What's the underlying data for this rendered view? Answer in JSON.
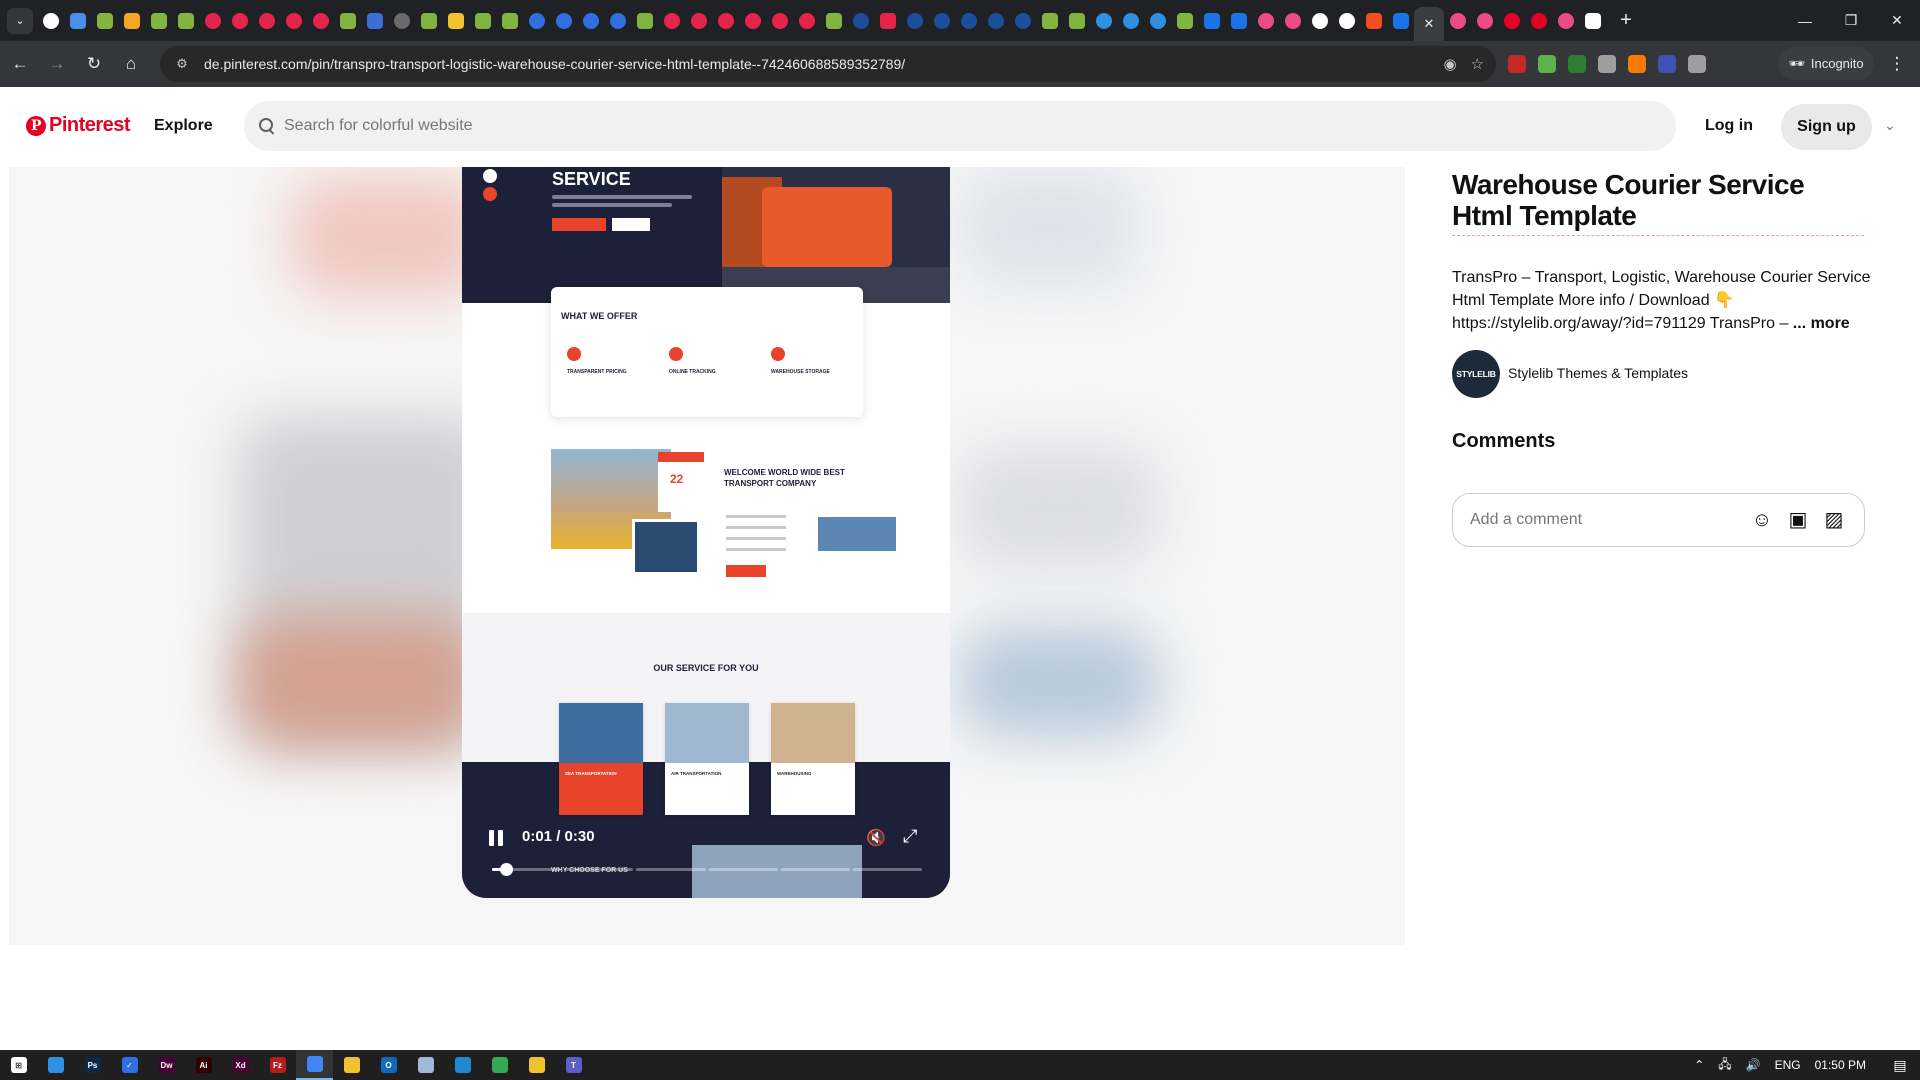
{
  "browser": {
    "tab_favicons": [
      {
        "name": "google-favicon",
        "color": "#ffffff",
        "round": true
      },
      {
        "name": "app-favicon",
        "color": "#4a8fe7"
      },
      {
        "name": "envato-favicon",
        "color": "#82b440"
      },
      {
        "name": "mx-favicon",
        "color": "#f5a623"
      },
      {
        "name": "envato-favicon",
        "color": "#82b440"
      },
      {
        "name": "envato-favicon",
        "color": "#82b440"
      },
      {
        "name": "record-favicon",
        "color": "#e5244c",
        "round": true
      },
      {
        "name": "record-favicon",
        "color": "#e5244c",
        "round": true
      },
      {
        "name": "record-favicon",
        "color": "#e5244c",
        "round": true
      },
      {
        "name": "record-favicon",
        "color": "#e5244c",
        "round": true
      },
      {
        "name": "record-favicon",
        "color": "#e5244c",
        "round": true
      },
      {
        "name": "envato-favicon",
        "color": "#82b440"
      },
      {
        "name": "le-favicon",
        "color": "#3a6fd8"
      },
      {
        "name": "globe-favicon",
        "color": "#6b6b6b",
        "round": true
      },
      {
        "name": "envato-favicon",
        "color": "#82b440"
      },
      {
        "name": "tool-favicon",
        "color": "#f2c12e"
      },
      {
        "name": "envato-favicon",
        "color": "#82b440"
      },
      {
        "name": "envato-favicon",
        "color": "#82b440"
      },
      {
        "name": "c-favicon",
        "color": "#2f6fe0",
        "round": true
      },
      {
        "name": "c-favicon",
        "color": "#2f6fe0",
        "round": true
      },
      {
        "name": "c-favicon",
        "color": "#2f6fe0",
        "round": true
      },
      {
        "name": "c-favicon",
        "color": "#2f6fe0",
        "round": true
      },
      {
        "name": "envato-favicon",
        "color": "#82b440"
      },
      {
        "name": "red-app-favicon",
        "color": "#e5244c",
        "round": true
      },
      {
        "name": "red-app-favicon",
        "color": "#e5244c",
        "round": true
      },
      {
        "name": "red-app-favicon",
        "color": "#e5244c",
        "round": true
      },
      {
        "name": "red-app-favicon",
        "color": "#e5244c",
        "round": true
      },
      {
        "name": "red-app-favicon",
        "color": "#e5244c",
        "round": true
      },
      {
        "name": "red-app-favicon",
        "color": "#e5244c",
        "round": true
      },
      {
        "name": "envato-favicon",
        "color": "#82b440"
      },
      {
        "name": "a-favicon",
        "color": "#1b4f9c",
        "round": true
      },
      {
        "name": "m-favicon",
        "color": "#e5244c"
      },
      {
        "name": "a-favicon",
        "color": "#1b4f9c",
        "round": true
      },
      {
        "name": "a-favicon",
        "color": "#1b4f9c",
        "round": true
      },
      {
        "name": "a-favicon",
        "color": "#1b4f9c",
        "round": true
      },
      {
        "name": "a-favicon",
        "color": "#1b4f9c",
        "round": true
      },
      {
        "name": "a-favicon",
        "color": "#1b4f9c",
        "round": true
      },
      {
        "name": "envato-favicon",
        "color": "#82b440"
      },
      {
        "name": "envato-favicon",
        "color": "#82b440"
      },
      {
        "name": "edge-favicon",
        "color": "#2f8fe0",
        "round": true
      },
      {
        "name": "edge-favicon",
        "color": "#2f8fe0",
        "round": true
      },
      {
        "name": "edge-favicon",
        "color": "#2f8fe0",
        "round": true
      },
      {
        "name": "envato-favicon",
        "color": "#82b440"
      },
      {
        "name": "blue-app-favicon",
        "color": "#1a73e8"
      },
      {
        "name": "blue-app-favicon",
        "color": "#1a73e8"
      },
      {
        "name": "dribbble-favicon",
        "color": "#ea4c89",
        "round": true
      },
      {
        "name": "dribbble-favicon",
        "color": "#ea4c89",
        "round": true
      },
      {
        "name": "chrome-favicon",
        "color": "#ffffff",
        "round": true
      },
      {
        "name": "chrome-favicon",
        "color": "#ffffff",
        "round": true
      },
      {
        "name": "figma-favicon",
        "color": "#f24e1e"
      },
      {
        "name": "blue-app-favicon",
        "color": "#1a73e8"
      }
    ],
    "tab_favicons_after": [
      {
        "name": "dribbble-favicon",
        "color": "#ea4c89",
        "round": true
      },
      {
        "name": "dribbble-favicon",
        "color": "#ea4c89",
        "round": true
      },
      {
        "name": "pinterest-favicon",
        "color": "#e60023",
        "round": true
      },
      {
        "name": "pinterest-favicon",
        "color": "#e60023",
        "round": true
      },
      {
        "name": "dribbble-favicon",
        "color": "#ea4c89",
        "round": true
      },
      {
        "name": "notion-favicon",
        "color": "#ffffff"
      }
    ],
    "active_tab_close": "✕",
    "new_tab": "+",
    "url": "de.pinterest.com/pin/transpro-transport-logistic-warehouse-courier-service-html-template--742460688589352789/",
    "incognito_label": "Incognito",
    "extensions": [
      {
        "name": "extension-red-icon",
        "color": "#c62828"
      },
      {
        "name": "extension-green-icon",
        "color": "#5fb04f"
      },
      {
        "name": "extension-be-icon",
        "color": "#2e7d32"
      },
      {
        "name": "extension-camera-icon",
        "color": "#9e9e9e"
      },
      {
        "name": "extension-orange-icon",
        "color": "#f57c00"
      },
      {
        "name": "extension-blue-icon",
        "color": "#3f51b5"
      },
      {
        "name": "extension-puzzle-icon",
        "color": "#9e9e9e"
      }
    ]
  },
  "header": {
    "logo_text": "Pinterest",
    "explore_label": "Explore",
    "search_placeholder": "Search for colorful website",
    "login_label": "Log in",
    "signup_label": "Sign up"
  },
  "media": {
    "hero_title": "SERVICE",
    "offer_title": "WHAT WE OFFER",
    "offer_cards": [
      {
        "label": "TRANSPARENT PRICING",
        "color": "#fde7e3"
      },
      {
        "label": "ONLINE TRACKING",
        "color": "#e6e6ea"
      },
      {
        "label": "WAREHOUSE STORAGE",
        "color": "#e3eefc"
      }
    ],
    "about_badge": "22",
    "about_title": "WELCOME WORLD WIDE BEST TRANSPORT COMPANY",
    "services_title": "OUR SERVICE FOR YOU",
    "service_cards": [
      {
        "label": "SEA TRANSPORTATION",
        "img": "#3f6d9e",
        "red": true
      },
      {
        "label": "AIR TRANSPORTATION",
        "img": "#9fb7cf",
        "red": false
      },
      {
        "label": "WAREHOUSING",
        "img": "#cfb28e",
        "red": false
      }
    ],
    "why_label": "WHY CHOOSE FOR US",
    "time": "0:01 / 0:30",
    "progress_segments": 6,
    "progress_fraction": 0.033
  },
  "pin": {
    "title": "Warehouse Courier Service Html Template",
    "description": "TransPro – Transport, Logistic, Warehouse Courier Service Html Template    More info / Download 👇 https://stylelib.org/away/?id=791129    TransPro –",
    "more_label": "... more",
    "author_avatar_text": "STYLELIB",
    "author_name": "Stylelib Themes & Templates",
    "comments_heading": "Comments",
    "comment_placeholder": "Add a comment"
  },
  "taskbar": {
    "apps": [
      {
        "name": "edge-taskbar-icon",
        "color": "#2f8fe0",
        "label": ""
      },
      {
        "name": "photoshop-taskbar-icon",
        "color": "#0b2a4a",
        "label": "Ps"
      },
      {
        "name": "todo-taskbar-icon",
        "color": "#2f6fe0",
        "label": "✓"
      },
      {
        "name": "dreamweaver-taskbar-icon",
        "color": "#470137",
        "label": "Dw"
      },
      {
        "name": "illustrator-taskbar-icon",
        "color": "#330000",
        "label": "Ai"
      },
      {
        "name": "xd-taskbar-icon",
        "color": "#470137",
        "label": "Xd"
      },
      {
        "name": "filezilla-taskbar-icon",
        "color": "#b31d1d",
        "label": "Fz"
      },
      {
        "name": "chrome-taskbar-icon",
        "color": "#4285f4",
        "label": ""
      },
      {
        "name": "sticky-notes-taskbar-icon",
        "color": "#f2c12e",
        "label": ""
      },
      {
        "name": "outlook-taskbar-icon",
        "color": "#0f6cbd",
        "label": "O"
      },
      {
        "name": "notepad-taskbar-icon",
        "color": "#9eb8d6",
        "label": ""
      },
      {
        "name": "vscode-taskbar-icon",
        "color": "#1f8ad2",
        "label": ""
      },
      {
        "name": "chrome-taskbar-icon",
        "color": "#34a853",
        "label": ""
      },
      {
        "name": "explorer-taskbar-icon",
        "color": "#f2c12e",
        "label": ""
      },
      {
        "name": "teams-taskbar-icon",
        "color": "#5b5fc7",
        "label": "T"
      }
    ],
    "language": "ENG",
    "clock": "01:50 PM"
  }
}
